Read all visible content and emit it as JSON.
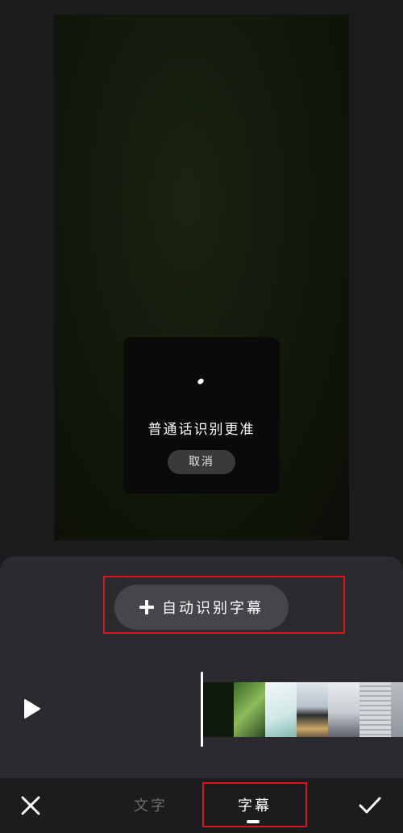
{
  "preview": {
    "recognition": {
      "message": "普通话识别更准",
      "cancel_label": "取消"
    }
  },
  "panel": {
    "auto_subtitle_label": "自动识别字幕"
  },
  "tabs": [
    {
      "label": "文字",
      "active": false
    },
    {
      "label": "字幕",
      "active": true
    }
  ],
  "timeline": {
    "frames": [
      "#0f1a0c",
      "#5c8c3a",
      "#e8eef0",
      "#a9b6c4",
      "#d9dcdf",
      "#c4c8cc",
      "#9aa0a6"
    ]
  },
  "colors": {
    "highlight": "#d9161c",
    "inactive_tab": "#6b6b6e",
    "active_tab": "#ffffff"
  },
  "icons": {
    "close": "close-icon",
    "confirm": "check-icon",
    "play": "play-icon",
    "add": "plus-icon"
  }
}
